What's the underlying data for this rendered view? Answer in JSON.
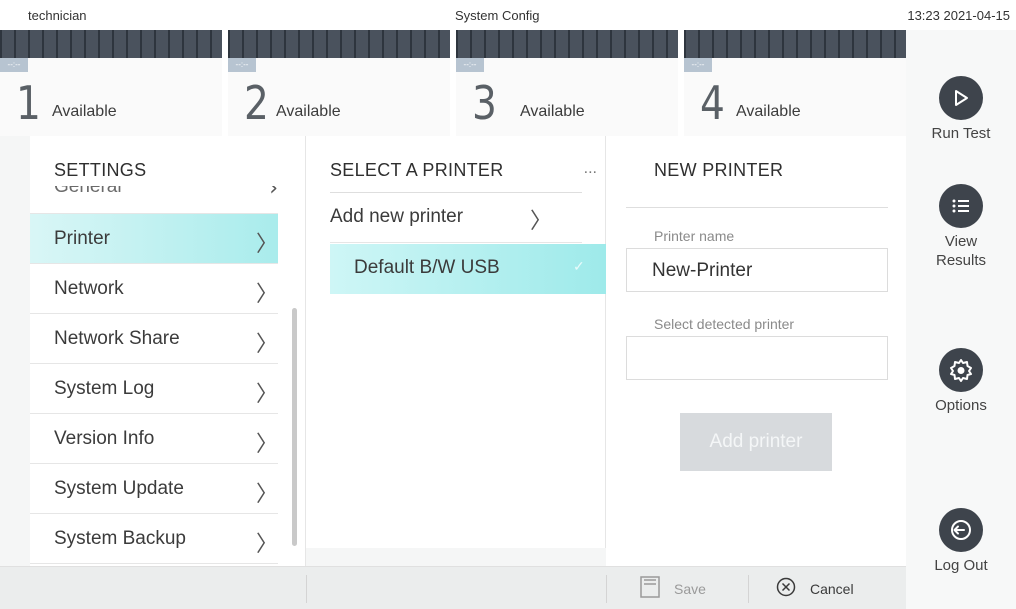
{
  "header": {
    "user": "technician",
    "title": "System Config",
    "datetime": "13:23 2021-04-15"
  },
  "bays": [
    {
      "number": "1",
      "status": "Available",
      "tag": "--:--"
    },
    {
      "number": "2",
      "status": "Available",
      "tag": "--:--"
    },
    {
      "number": "3",
      "status": "Available",
      "tag": "--:--"
    },
    {
      "number": "4",
      "status": "Available",
      "tag": "--:--"
    }
  ],
  "rail": {
    "run_test": "Run Test",
    "view_results_1": "View",
    "view_results_2": "Results",
    "options": "Options",
    "log_out": "Log Out"
  },
  "settings": {
    "title": "SETTINGS",
    "items": [
      {
        "label": "General"
      },
      {
        "label": "Printer"
      },
      {
        "label": "Network"
      },
      {
        "label": "Network Share"
      },
      {
        "label": "System Log"
      },
      {
        "label": "Version Info"
      },
      {
        "label": "System Update"
      },
      {
        "label": "System Backup"
      }
    ],
    "selected": "Printer"
  },
  "printers": {
    "title": "SELECT A PRINTER",
    "more": "...",
    "add_new": "Add new printer",
    "list": [
      {
        "label": "Default B/W USB",
        "check": "✓"
      }
    ]
  },
  "new_printer": {
    "title": "NEW PRINTER",
    "name_label": "Printer name",
    "name_value": "New-Printer",
    "detected_label": "Select detected printer",
    "detected_value": "",
    "add_button": "Add printer"
  },
  "bottombar": {
    "save": "Save",
    "cancel": "Cancel"
  },
  "colors": {
    "selected_bg": "#a9ecec",
    "rail_icon": "#3e444c",
    "bay_header": "#3d4550"
  },
  "icons": {
    "run_test": "play-icon",
    "view_results": "list-icon",
    "options": "gear-icon",
    "log_out": "logout-icon",
    "save": "save-icon",
    "cancel": "cancel-circle-icon"
  }
}
